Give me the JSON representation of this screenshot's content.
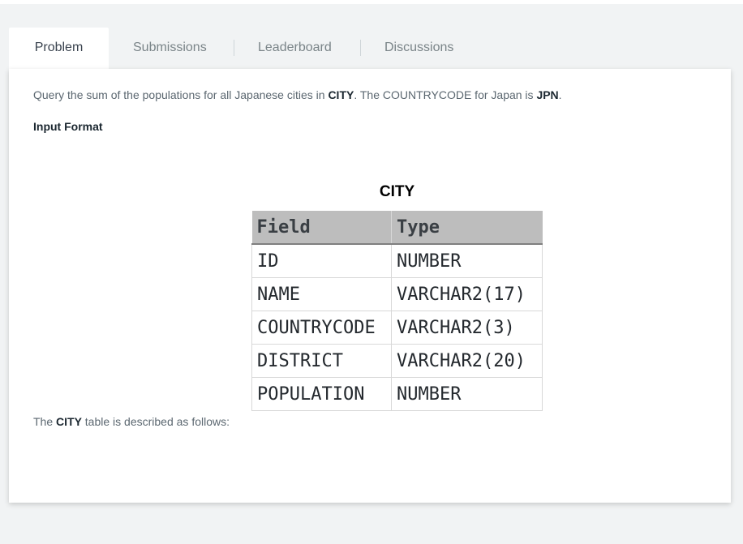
{
  "tabs": [
    {
      "label": "Problem",
      "active": true
    },
    {
      "label": "Submissions",
      "active": false
    },
    {
      "label": "Leaderboard",
      "active": false
    },
    {
      "label": "Discussions",
      "active": false
    }
  ],
  "problem": {
    "description": {
      "pre": "Query the sum of the populations for all Japanese cities in ",
      "table_name": "CITY",
      "mid": ". The COUNTRYCODE for Japan is ",
      "code": "JPN",
      "post": "."
    },
    "input_format_title": "Input Format",
    "table_caption": "CITY",
    "schema_headers": [
      "Field",
      "Type"
    ],
    "schema_rows": [
      {
        "field": "ID",
        "type": "NUMBER"
      },
      {
        "field": "NAME",
        "type": "VARCHAR2(17)"
      },
      {
        "field": "COUNTRYCODE",
        "type": "VARCHAR2(3)"
      },
      {
        "field": "DISTRICT",
        "type": "VARCHAR2(20)"
      },
      {
        "field": "POPULATION",
        "type": "NUMBER"
      }
    ],
    "after_text": {
      "pre": "The ",
      "table_name": "CITY",
      "post": " table is described as follows:"
    }
  },
  "colors": {
    "page_bg": "#f1f3f4",
    "panel_bg": "#ffffff",
    "header_bg": "#bdbdbd",
    "text": "#5b6770",
    "strong_text": "#1b2730"
  }
}
